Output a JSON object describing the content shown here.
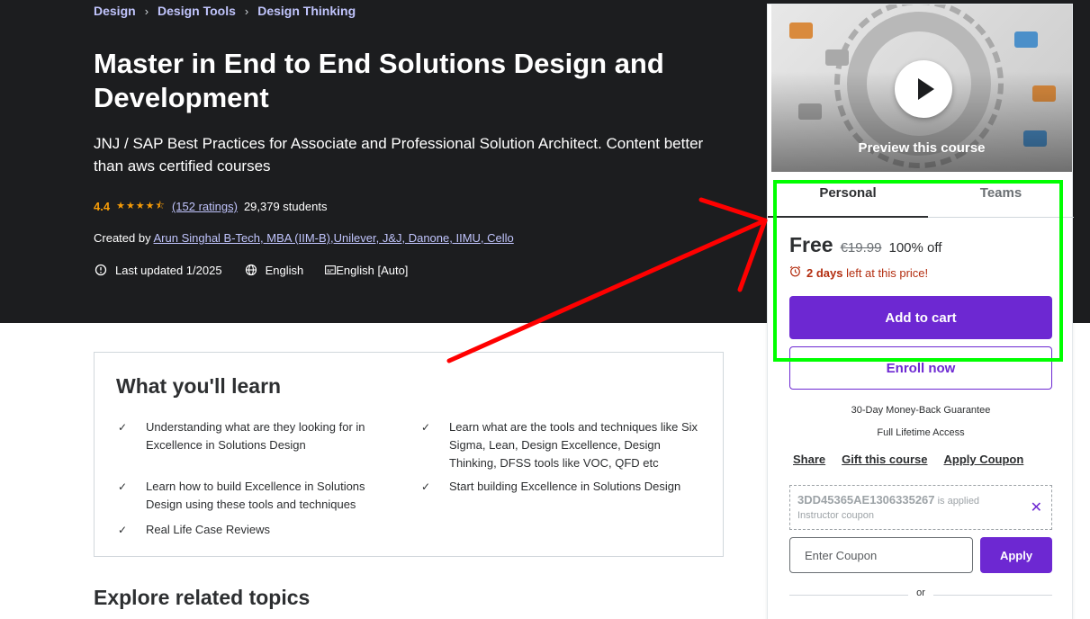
{
  "breadcrumb": [
    "Design",
    "Design Tools",
    "Design Thinking"
  ],
  "course": {
    "title": "Master in End to End Solutions Design and Development",
    "subtitle": "JNJ / SAP Best Practices for Associate and Professional Solution Architect. Content better than aws certified courses",
    "rating": "4.4",
    "stars": "★★★★⯪",
    "rating_count": "(152 ratings)",
    "students": "29,379 students",
    "created_by_label": "Created by",
    "instructor": "Arun Singhal B-Tech, MBA (IIM-B),Unilever, J&J, Danone, IIMU, Cello",
    "last_updated": "Last updated 1/2025",
    "language": "English",
    "captions": "English [Auto]"
  },
  "learn": {
    "title": "What you'll learn",
    "items": [
      "Understanding what are they looking for in Excellence in Solutions Design",
      "Learn what are the tools and techniques like Six Sigma, Lean, Design Excellence, Design Thinking, DFSS tools like VOC, QFD etc",
      "Learn how to build Excellence in Solutions Design using these tools and techniques",
      "Start building Excellence in Solutions Design",
      "Real Life Case Reviews"
    ]
  },
  "explore_title": "Explore related topics",
  "sidebar": {
    "preview_text": "Preview this course",
    "tabs": [
      "Personal",
      "Teams"
    ],
    "price": "Free",
    "original_price": "€19.99",
    "discount": "100% off",
    "timer_bold": "2 days",
    "timer_rest": " left at this price!",
    "add_to_cart": "Add to cart",
    "enroll_now": "Enroll now",
    "guarantee": "30-Day Money-Back Guarantee",
    "lifetime": "Full Lifetime Access",
    "links": [
      "Share",
      "Gift this course",
      "Apply Coupon"
    ],
    "coupon_code": "3DD45365AE1306335267",
    "coupon_applied": " is applied",
    "coupon_type": "Instructor coupon",
    "coupon_placeholder": "Enter Coupon",
    "apply": "Apply",
    "or": "or"
  },
  "colors": {
    "hero_bg": "#1c1d1f",
    "accent_purple": "#6d28d2",
    "link_lavender": "#c0c4fc",
    "star_orange": "#f69c08",
    "timer_red": "#b32d0f",
    "annotation_green": "#00ff00",
    "annotation_red": "#ff0000"
  }
}
